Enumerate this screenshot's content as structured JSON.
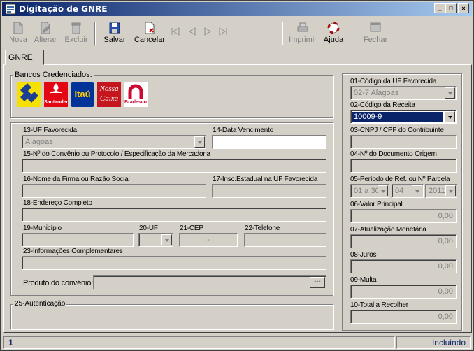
{
  "window": {
    "title": "Digitação de GNRE"
  },
  "toolbar": {
    "nova": "Nova",
    "alterar": "Alterar",
    "excluir": "Excluir",
    "salvar": "Salvar",
    "cancelar": "Cancelar",
    "imprimir": "Imprimir",
    "ajuda": "Ajuda",
    "fechar": "Fechar"
  },
  "tabs": {
    "gnre": "GNRE"
  },
  "bancos": {
    "legend": "Bancos Credenciados:",
    "santander": "Santander",
    "itau": "Itaú",
    "nossa1": "Nossa",
    "nossa2": "Caixa",
    "bradesco": "Bradesco"
  },
  "form": {
    "uf_label": "13-UF Favorecida",
    "uf_value": "Alagoas",
    "venc_label": "14-Data Vencimento",
    "convenio_label": "15-Nº do Convênio ou Protocolo / Especificação da Mercadoria",
    "nome_label": "16-Nome da Firma ou Razão Social",
    "insc_label": "17-Insc.Estadual na UF Favorecida",
    "endereco_label": "18-Endereço Completo",
    "municipio_label": "19-Município",
    "uf20_label": "20-UF",
    "cep_label": "21-CEP",
    "cep_value": "-",
    "telefone_label": "22-Telefone",
    "info_label": "23-Informações Complementares",
    "produto_label": "Produto do convênio:",
    "autenticacao_legend": "25-Autenticação"
  },
  "right": {
    "codigo_uf_label": "01-Código da UF Favorecida",
    "codigo_uf_value": "02-7 Alagoas",
    "codigo_receita_label": "02-Código da Receita",
    "codigo_receita_value": "10009-9",
    "cnpj_label": "03-CNPJ / CPF do Contribuinte",
    "doc_origem_label": "04-Nº do Documento Origem",
    "periodo_label": "05-Período de Ref. ou Nº Parcela",
    "periodo_parte": "01 a 30",
    "periodo_mes": "04",
    "periodo_ano": "2011",
    "valor_principal_label": "06-Valor Principal",
    "valor_principal": "0,00",
    "atualizacao_label": "07-Atualização Monetária",
    "atualizacao": "0,00",
    "juros_label": "08-Juros",
    "juros": "0,00",
    "multa_label": "09-Multa",
    "multa": "0,00",
    "total_label": "10-Total a Recolher",
    "total": "0,00"
  },
  "status": {
    "record": "1",
    "mode": "Incluindo"
  },
  "colors": {
    "title_start": "#0a246a",
    "title_end": "#a6caf0",
    "face": "#d4d0c8",
    "selection": "#0a246a"
  }
}
